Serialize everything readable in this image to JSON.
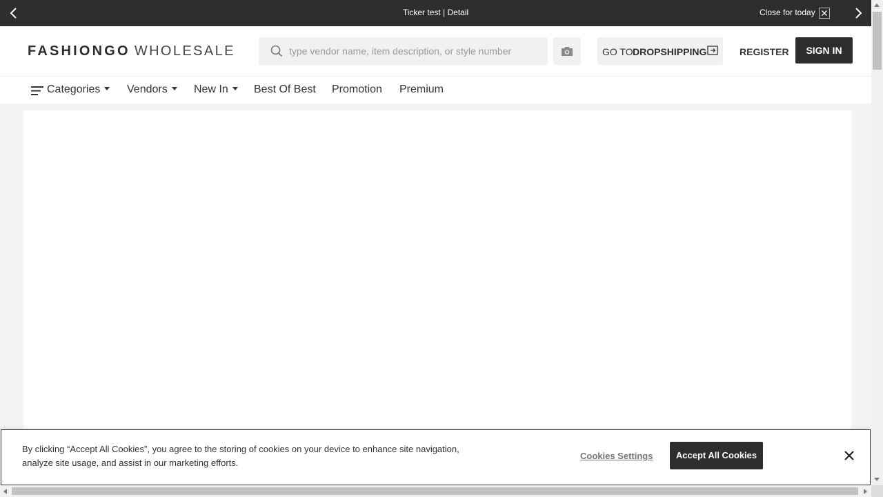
{
  "ticker": {
    "text": "Ticker test | Detail",
    "close_label": "Close for today",
    "prev_icon": "chevron-left-icon",
    "next_icon": "chevron-right-icon"
  },
  "header": {
    "logo_brand": "FASHIONGO",
    "logo_sub": "WHOLESALE",
    "search": {
      "placeholder": "type vendor name, item description, or style number",
      "value": ""
    },
    "dropship": {
      "prefix": "GO TO",
      "label": "DROPSHIPPING"
    },
    "register_label": "REGISTER",
    "signin_label": "SIGN IN"
  },
  "nav": {
    "items": [
      {
        "label": "Categories",
        "dropdown": true
      },
      {
        "label": "Vendors",
        "dropdown": true
      },
      {
        "label": "New In",
        "dropdown": true
      },
      {
        "label": "Best Of Best",
        "dropdown": false
      },
      {
        "label": "Promotion",
        "dropdown": false
      },
      {
        "label": "Premium",
        "dropdown": false
      }
    ]
  },
  "cookie": {
    "message": "By clicking “Accept All Cookies”, you agree to the storing of cookies on your device to enhance site navigation, analyze site usage, and assist in our marketing efforts.",
    "settings_label": "Cookies Settings",
    "accept_label": "Accept All Cookies"
  },
  "colors": {
    "dark": "#2d2d2d",
    "page_bg": "#f4f4f4",
    "input_bg": "#f1f1f1"
  }
}
